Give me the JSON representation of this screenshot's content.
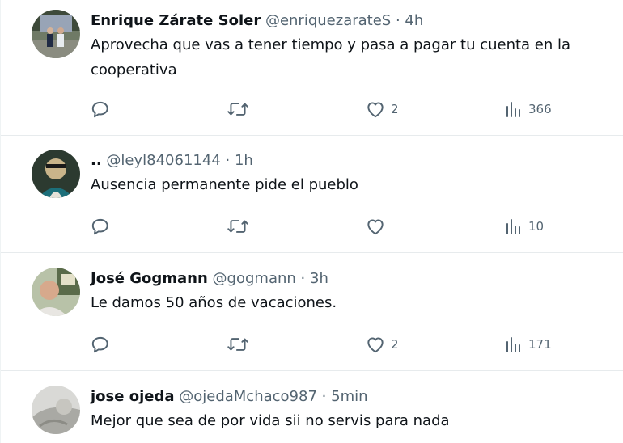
{
  "tweets": [
    {
      "name": "Enrique Zárate Soler",
      "handle": "@enriquezarateS",
      "dot": "·",
      "time": "4h",
      "text_lines": [
        "Aprovecha que vas a tener tiempo y pasa a pagar tu cuenta en la",
        "cooperativa"
      ],
      "likes": "2",
      "views": "366"
    },
    {
      "name": "..",
      "handle": "@leyl84061144",
      "dot": "·",
      "time": "1h",
      "text_lines": [
        "Ausencia permanente pide el pueblo"
      ],
      "likes": "",
      "views": "10"
    },
    {
      "name": "José Gogmann",
      "handle": "@gogmann",
      "dot": "·",
      "time": "3h",
      "text_lines": [
        "Le damos 50 años de vacaciones."
      ],
      "likes": "2",
      "views": "171"
    },
    {
      "name": "jose ojeda",
      "handle": "@ojedaMchaco987",
      "dot": "·",
      "time": "5min",
      "text_lines": [
        "Mejor que sea de por vida sii no servis para nada"
      ]
    }
  ],
  "icons": {
    "reply": "reply-icon",
    "retweet": "retweet-icon",
    "like": "heart-icon",
    "views": "views-icon"
  },
  "colors": {
    "text_primary": "#0f1419",
    "text_secondary": "#536471",
    "divider": "#e7ebed"
  }
}
